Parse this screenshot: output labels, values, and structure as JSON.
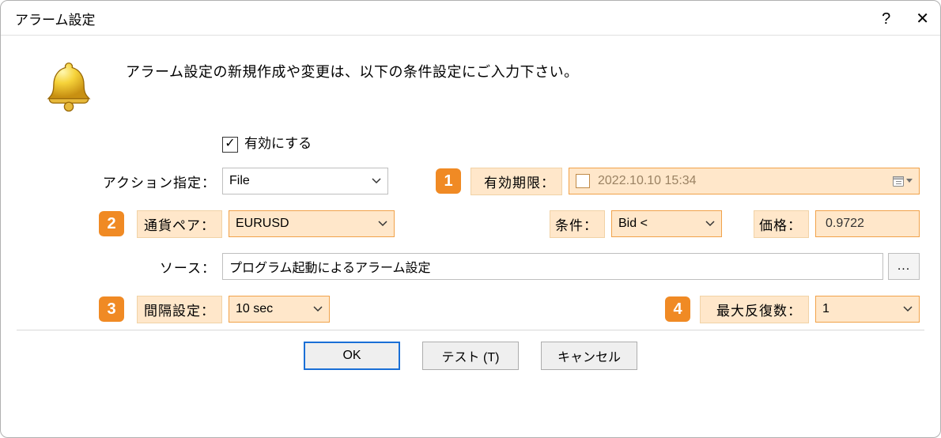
{
  "titlebar": {
    "title": "アラーム設定",
    "help": "?",
    "close": "✕"
  },
  "instruction": "アラーム設定の新規作成や変更は、以下の条件設定にご入力下さい。",
  "markers": {
    "m1": "1",
    "m2": "2",
    "m3": "3",
    "m4": "4"
  },
  "enable": {
    "label": "有効にする",
    "checked": true
  },
  "actionRow": {
    "label": "アクション指定：",
    "value": "File"
  },
  "expiryRow": {
    "label": "有効期限：",
    "value": "2022.10.10 15:34",
    "checked": false
  },
  "pairRow": {
    "label": "通貨ペア：",
    "value": "EURUSD"
  },
  "conditionRow": {
    "label": "条件：",
    "value": "Bid <"
  },
  "priceRow": {
    "label": "価格：",
    "value": "0.9722"
  },
  "sourceRow": {
    "label": "ソース：",
    "value": "プログラム起動によるアラーム設定",
    "browse": "..."
  },
  "intervalRow": {
    "label": "間隔設定：",
    "value": "10 sec"
  },
  "maxRepeatRow": {
    "label": "最大反復数：",
    "value": "1"
  },
  "buttons": {
    "ok": "OK",
    "test": "テスト (T)",
    "cancel": "キャンセル"
  }
}
